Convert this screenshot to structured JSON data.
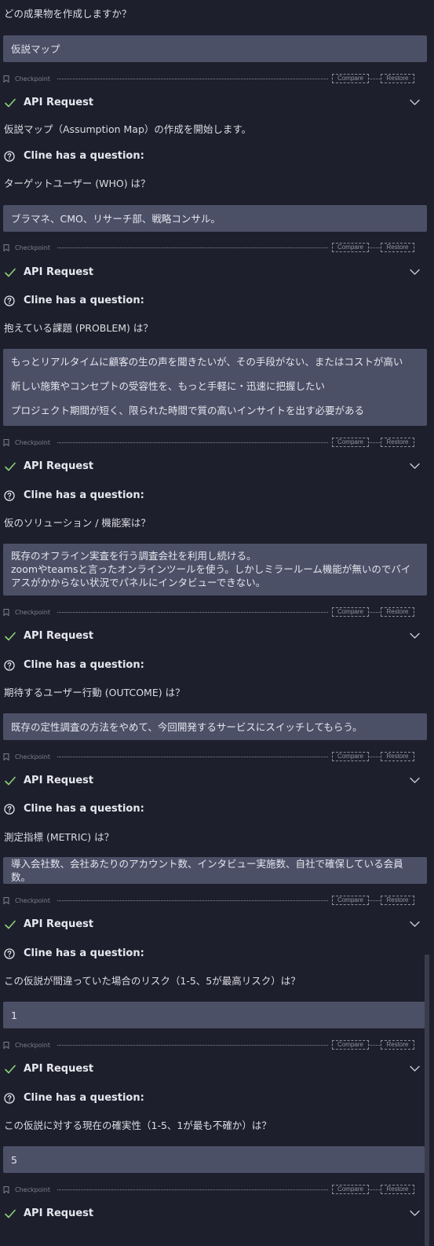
{
  "intro_question": "どの成果物を作成しますか？",
  "intro_answer": "仮説マップ",
  "checkpoint_label": "Checkpoint",
  "compare_label": "Compare",
  "restore_label": "Restore",
  "api_request_label": "API Request",
  "question_header": "Cline has a question:",
  "start_message": "仮説マップ（Assumption Map）の作成を開始します。",
  "qa": [
    {
      "question": "ターゲットユーザー (WHO) は？",
      "answer": [
        "ブラマネ、CMO、リサーチ部、戦略コンサル。"
      ]
    },
    {
      "question": "抱えている課題 (PROBLEM) は？",
      "answer": [
        "もっとリアルタイムに顧客の生の声を聞きたいが、その手段がない、またはコストが高い",
        "新しい施策やコンセプトの受容性を、もっと手軽に・迅速に把握したい",
        "プロジェクト期間が短く、限られた時間で質の高いインサイトを出す必要がある"
      ]
    },
    {
      "question": "仮のソリューション / 機能案は？",
      "answer": [
        "既存のオフライン実査を行う調査会社を利用し続ける。",
        "zoomやteamsと言ったオンラインツールを使う。しかしミラールーム機能が無いのでバイアスがかからない状況でパネルにインタビューできない。"
      ]
    },
    {
      "question": "期待するユーザー行動 (OUTCOME) は？",
      "answer": [
        "既存の定性調査の方法をやめて、今回開発するサービスにスイッチしてもらう。"
      ]
    },
    {
      "question": "測定指標 (METRIC) は？",
      "answer": [
        "導入会社数、会社あたりのアカウント数、インタビュー実施数、自社で確保している会員数。"
      ]
    },
    {
      "question": "この仮説が間違っていた場合のリスク（1-5、5が最高リスク）は？",
      "answer": [
        "1"
      ]
    },
    {
      "question": "この仮説に対する現在の確実性（1-5、1が最も不確か）は？",
      "answer": [
        "5"
      ]
    }
  ]
}
